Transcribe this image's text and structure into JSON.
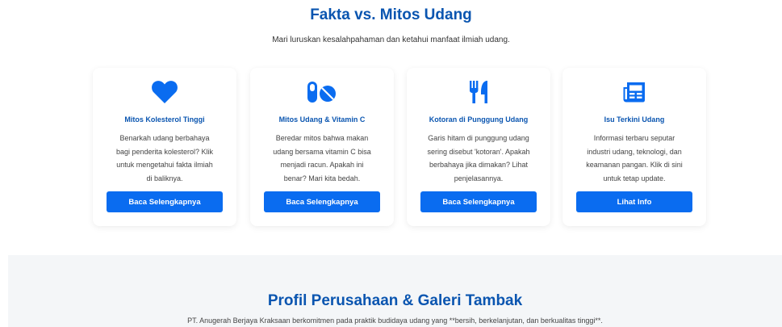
{
  "header": {
    "title": "Fakta vs. Mitos Udang",
    "subtitle": "Mari luruskan kesalahpahaman dan ketahui manfaat ilmiah udang."
  },
  "cards": [
    {
      "icon": "heart-icon",
      "title": "Mitos Kolesterol Tinggi",
      "lines": [
        "Benarkah udang berbahaya",
        "bagi penderita kolesterol? Klik",
        "untuk mengetahui fakta ilmiah",
        "di baliknya."
      ],
      "button": "Baca Selengkapnya"
    },
    {
      "icon": "pills-icon",
      "title": "Mitos Udang & Vitamin C",
      "lines": [
        "Beredar mitos bahwa makan",
        "udang bersama vitamin C bisa",
        "menjadi racun. Apakah ini",
        "benar? Mari kita bedah."
      ],
      "button": "Baca Selengkapnya"
    },
    {
      "icon": "utensils-icon",
      "title": "Kotoran di Punggung Udang",
      "lines": [
        "Garis hitam di punggung udang",
        "sering disebut 'kotoran'. Apakah",
        "berbahaya jika dimakan? Lihat",
        "penjelasannya."
      ],
      "button": "Baca Selengkapnya"
    },
    {
      "icon": "newspaper-icon",
      "title": "Isu Terkini Udang",
      "lines": [
        "Informasi terbaru seputar",
        "industri udang, teknologi, dan",
        "keamanan pangan. Klik di sini",
        "untuk tetap update."
      ],
      "button": "Lihat Info"
    }
  ],
  "profile": {
    "title": "Profil Perusahaan & Galeri Tambak",
    "description": "PT. Anugerah Berjaya Kraksaan berkomitmen pada praktik budidaya udang yang **bersih, berkelanjutan, dan berkualitas tinggi**."
  },
  "colors": {
    "accent": "#0a55b0",
    "button": "#0a6cf0",
    "icon": "#0a6cf0",
    "section_bg": "#f4f6f8"
  }
}
